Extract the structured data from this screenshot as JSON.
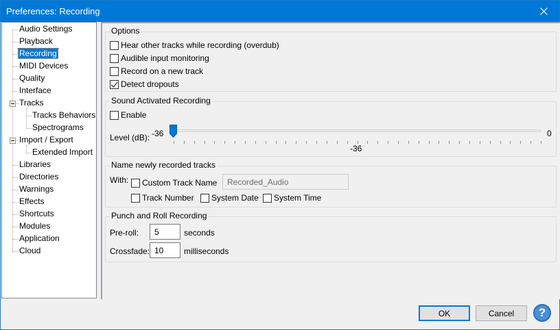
{
  "window": {
    "title": "Preferences: Recording"
  },
  "tree": {
    "items": [
      {
        "label": "Audio Settings"
      },
      {
        "label": "Playback"
      },
      {
        "label": "Recording",
        "selected": true
      },
      {
        "label": "MIDI Devices"
      },
      {
        "label": "Quality"
      },
      {
        "label": "Interface"
      },
      {
        "label": "Tracks",
        "expanded": true
      },
      {
        "label": "Tracks Behaviors",
        "child": true
      },
      {
        "label": "Spectrograms",
        "child": true
      },
      {
        "label": "Import / Export",
        "expanded": true
      },
      {
        "label": "Extended Import",
        "child": true
      },
      {
        "label": "Libraries"
      },
      {
        "label": "Directories"
      },
      {
        "label": "Warnings"
      },
      {
        "label": "Effects"
      },
      {
        "label": "Shortcuts"
      },
      {
        "label": "Modules"
      },
      {
        "label": "Application"
      },
      {
        "label": "Cloud"
      }
    ]
  },
  "options": {
    "title": "Options",
    "overdub": {
      "label": "Hear other tracks while recording (overdub)",
      "checked": false
    },
    "monitoring": {
      "label": "Audible input monitoring",
      "checked": false
    },
    "new_track": {
      "label": "Record on a new track",
      "checked": false
    },
    "dropouts": {
      "label": "Detect dropouts",
      "checked": true
    }
  },
  "sound_activated": {
    "title": "Sound Activated Recording",
    "enable": {
      "label": "Enable",
      "checked": false
    },
    "level_label": "Level (dB):",
    "min_label": "-36",
    "max_label": "0",
    "value_label": "-36",
    "value": -36,
    "min": -36,
    "max": 0
  },
  "naming": {
    "title": "Name newly recorded tracks",
    "with_label": "With:",
    "custom_name": {
      "label": "Custom Track Name",
      "checked": false
    },
    "custom_name_value": "Recorded_Audio",
    "track_number": {
      "label": "Track Number",
      "checked": false
    },
    "system_date": {
      "label": "System Date",
      "checked": false
    },
    "system_time": {
      "label": "System Time",
      "checked": false
    }
  },
  "punch": {
    "title": "Punch and Roll Recording",
    "preroll_label": "Pre-roll:",
    "preroll_value": "5",
    "preroll_unit": "seconds",
    "crossfade_label": "Crossfade:",
    "crossfade_value": "10",
    "crossfade_unit": "milliseconds"
  },
  "buttons": {
    "ok": "OK",
    "cancel": "Cancel",
    "help": "?"
  },
  "colors": {
    "titlebar": "#0078d7",
    "selection": "#0078d7",
    "slider_thumb": "#0078d7"
  }
}
